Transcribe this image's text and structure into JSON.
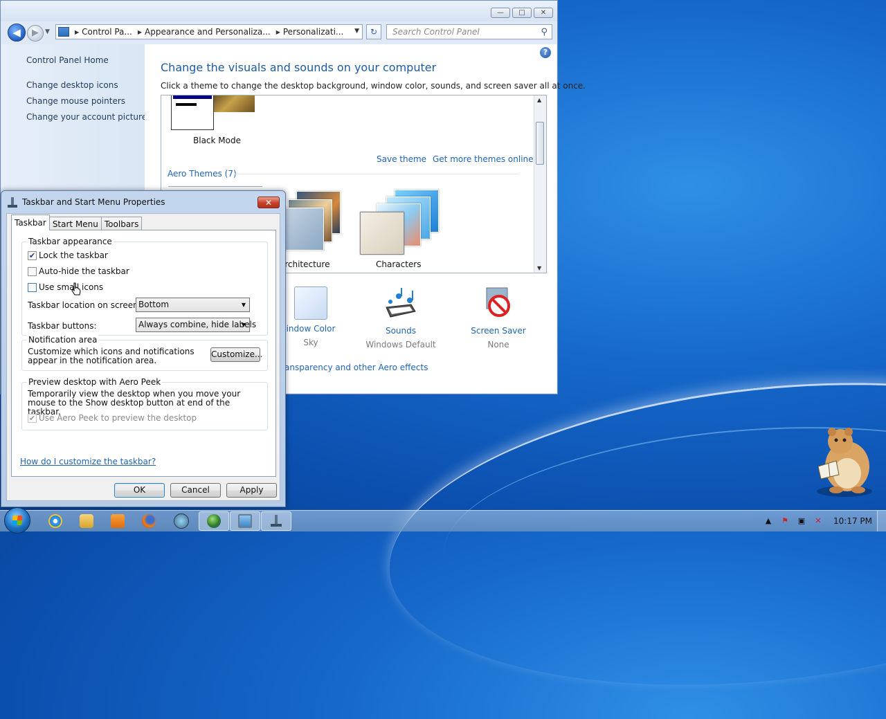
{
  "control_panel": {
    "address": {
      "crumbs": [
        "Control Pa...",
        "Appearance and Personaliza...",
        "Personalizati..."
      ]
    },
    "search_placeholder": "Search Control Panel",
    "sidebar": {
      "home": "Control Panel Home",
      "links": [
        "Change desktop icons",
        "Change mouse pointers",
        "Change your account picture"
      ]
    },
    "heading": "Change the visuals and sounds on your computer",
    "subheading": "Click a theme to change the desktop background, window color, sounds, and screen saver all at once.",
    "themes": {
      "current_theme": "Black Mode",
      "save_theme": "Save theme",
      "get_more": "Get more themes online",
      "aero_heading": "Aero Themes (7)",
      "aero": [
        "Architecture",
        "Characters"
      ]
    },
    "bottom": {
      "window_color": {
        "name": "indow Color",
        "value": "Sky"
      },
      "sounds": {
        "name": "Sounds",
        "value": "Windows Default"
      },
      "screen_saver": {
        "name": "Screen Saver",
        "value": "None"
      },
      "aero_link": "ansparency and other Aero effects"
    }
  },
  "dialog": {
    "title": "Taskbar and Start Menu Properties",
    "tabs": [
      "Taskbar",
      "Start Menu",
      "Toolbars"
    ],
    "appearance": {
      "title": "Taskbar appearance",
      "lock": {
        "label": "Lock the taskbar",
        "checked": true
      },
      "autohide": {
        "label": "Auto-hide the taskbar",
        "checked": false
      },
      "small_icons": {
        "label": "Use small icons",
        "checked": false
      },
      "location_label": "Taskbar location on screen:",
      "location_value": "Bottom",
      "buttons_label": "Taskbar buttons:",
      "buttons_value": "Always combine, hide labels"
    },
    "notification": {
      "title": "Notification area",
      "desc": "Customize which icons and notifications appear in the notification area.",
      "button": "Customize..."
    },
    "peek": {
      "title": "Preview desktop with Aero Peek",
      "desc": "Temporarily view the desktop when you move your mouse to the Show desktop button at end of the taskbar.",
      "checkbox": {
        "label": "Use Aero Peek to preview the desktop",
        "checked": true,
        "disabled": true
      }
    },
    "help_link": "How do I customize the taskbar?",
    "buttons": {
      "ok": "OK",
      "cancel": "Cancel",
      "apply": "Apply"
    }
  },
  "taskbar": {
    "pinned": [
      "internet-explorer-icon",
      "windows-explorer-icon",
      "media-player-icon",
      "firefox-icon",
      "network-icon",
      "globe-icon",
      "display-icon",
      "taskbar-properties-icon"
    ],
    "clock": "10:17 PM"
  },
  "colors": {
    "link_blue": "#1f63b3",
    "heading_blue": "#1e5aa0",
    "close_red": "#c8412b"
  }
}
